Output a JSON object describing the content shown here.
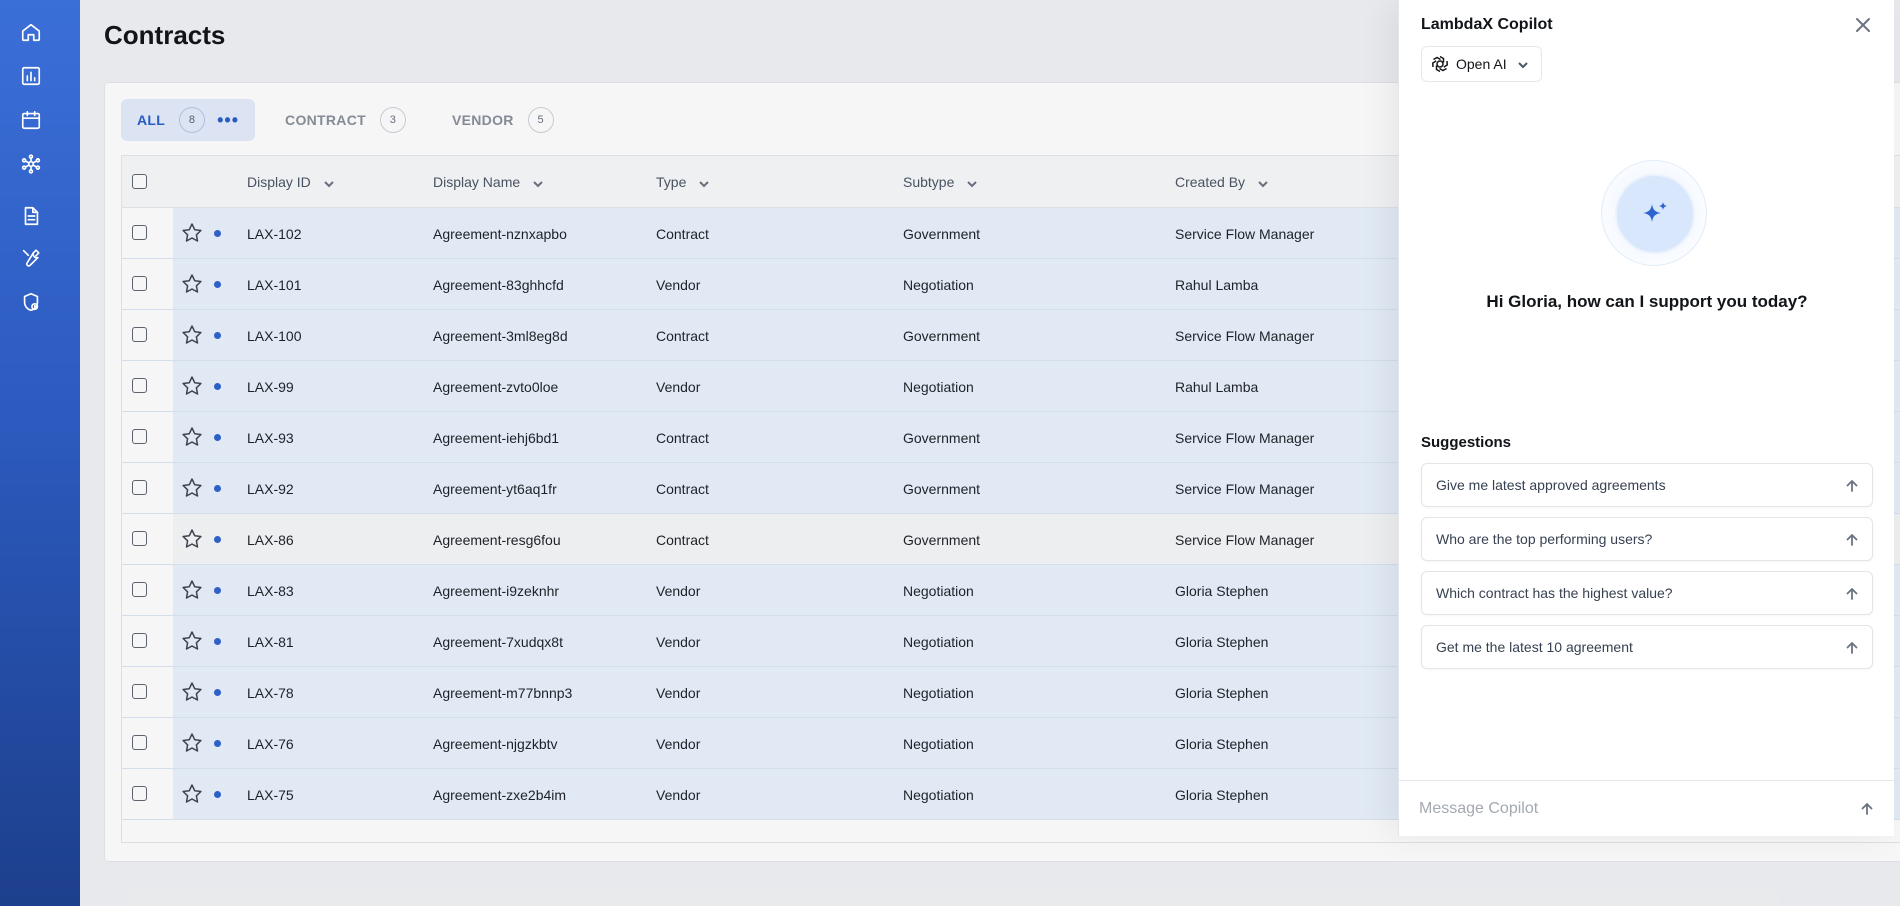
{
  "page": {
    "title": "Contracts"
  },
  "sidebar": {
    "items": [
      {
        "name": "home-icon"
      },
      {
        "name": "chart-icon"
      },
      {
        "name": "calendar-icon"
      },
      {
        "name": "network-icon"
      },
      {
        "name": "document-icon"
      },
      {
        "name": "wrench-icon"
      },
      {
        "name": "shield-icon"
      }
    ]
  },
  "tabs": [
    {
      "label": "ALL",
      "count": "8",
      "active": true
    },
    {
      "label": "CONTRACT",
      "count": "3"
    },
    {
      "label": "VENDOR",
      "count": "5"
    }
  ],
  "table": {
    "columns": [
      "Display ID",
      "Display Name",
      "Type",
      "Subtype",
      "Created By"
    ],
    "rows": [
      {
        "id": "LAX-102",
        "name": "Agreement-nznxapbo",
        "type": "Contract",
        "subtype": "Government",
        "created_by": "Service Flow Manager"
      },
      {
        "id": "LAX-101",
        "name": "Agreement-83ghhcfd",
        "type": "Vendor",
        "subtype": "Negotiation",
        "created_by": "Rahul Lamba"
      },
      {
        "id": "LAX-100",
        "name": "Agreement-3ml8eg8d",
        "type": "Contract",
        "subtype": "Government",
        "created_by": "Service Flow Manager"
      },
      {
        "id": "LAX-99",
        "name": "Agreement-zvto0loe",
        "type": "Vendor",
        "subtype": "Negotiation",
        "created_by": "Rahul Lamba"
      },
      {
        "id": "LAX-93",
        "name": "Agreement-iehj6bd1",
        "type": "Contract",
        "subtype": "Government",
        "created_by": "Service Flow Manager"
      },
      {
        "id": "LAX-92",
        "name": "Agreement-yt6aq1fr",
        "type": "Contract",
        "subtype": "Government",
        "created_by": "Service Flow Manager"
      },
      {
        "id": "LAX-86",
        "name": "Agreement-resg6fou",
        "type": "Contract",
        "subtype": "Government",
        "created_by": "Service Flow Manager"
      },
      {
        "id": "LAX-83",
        "name": "Agreement-i9zeknhr",
        "type": "Vendor",
        "subtype": "Negotiation",
        "created_by": "Gloria Stephen"
      },
      {
        "id": "LAX-81",
        "name": "Agreement-7xudqx8t",
        "type": "Vendor",
        "subtype": "Negotiation",
        "created_by": "Gloria Stephen"
      },
      {
        "id": "LAX-78",
        "name": "Agreement-m77bnnp3",
        "type": "Vendor",
        "subtype": "Negotiation",
        "created_by": "Gloria Stephen"
      },
      {
        "id": "LAX-76",
        "name": "Agreement-njgzkbtv",
        "type": "Vendor",
        "subtype": "Negotiation",
        "created_by": "Gloria Stephen"
      },
      {
        "id": "LAX-75",
        "name": "Agreement-zxe2b4im",
        "type": "Vendor",
        "subtype": "Negotiation",
        "created_by": "Gloria Stephen"
      }
    ]
  },
  "copilot": {
    "title": "LambdaX Copilot",
    "model": "Open AI",
    "greeting": "Hi Gloria, how can I support you today?",
    "suggestions_label": "Suggestions",
    "suggestions": [
      "Give me latest approved agreements",
      "Who are the top performing users?",
      "Which contract has the highest value?",
      "Get me the latest 10 agreement"
    ],
    "input_placeholder": "Message Copilot"
  },
  "colors": {
    "accent": "#2f63cf",
    "row_highlight": "#e9f2fc",
    "sidebar_top": "#3b6fd8",
    "sidebar_bottom": "#1d3f8c"
  }
}
